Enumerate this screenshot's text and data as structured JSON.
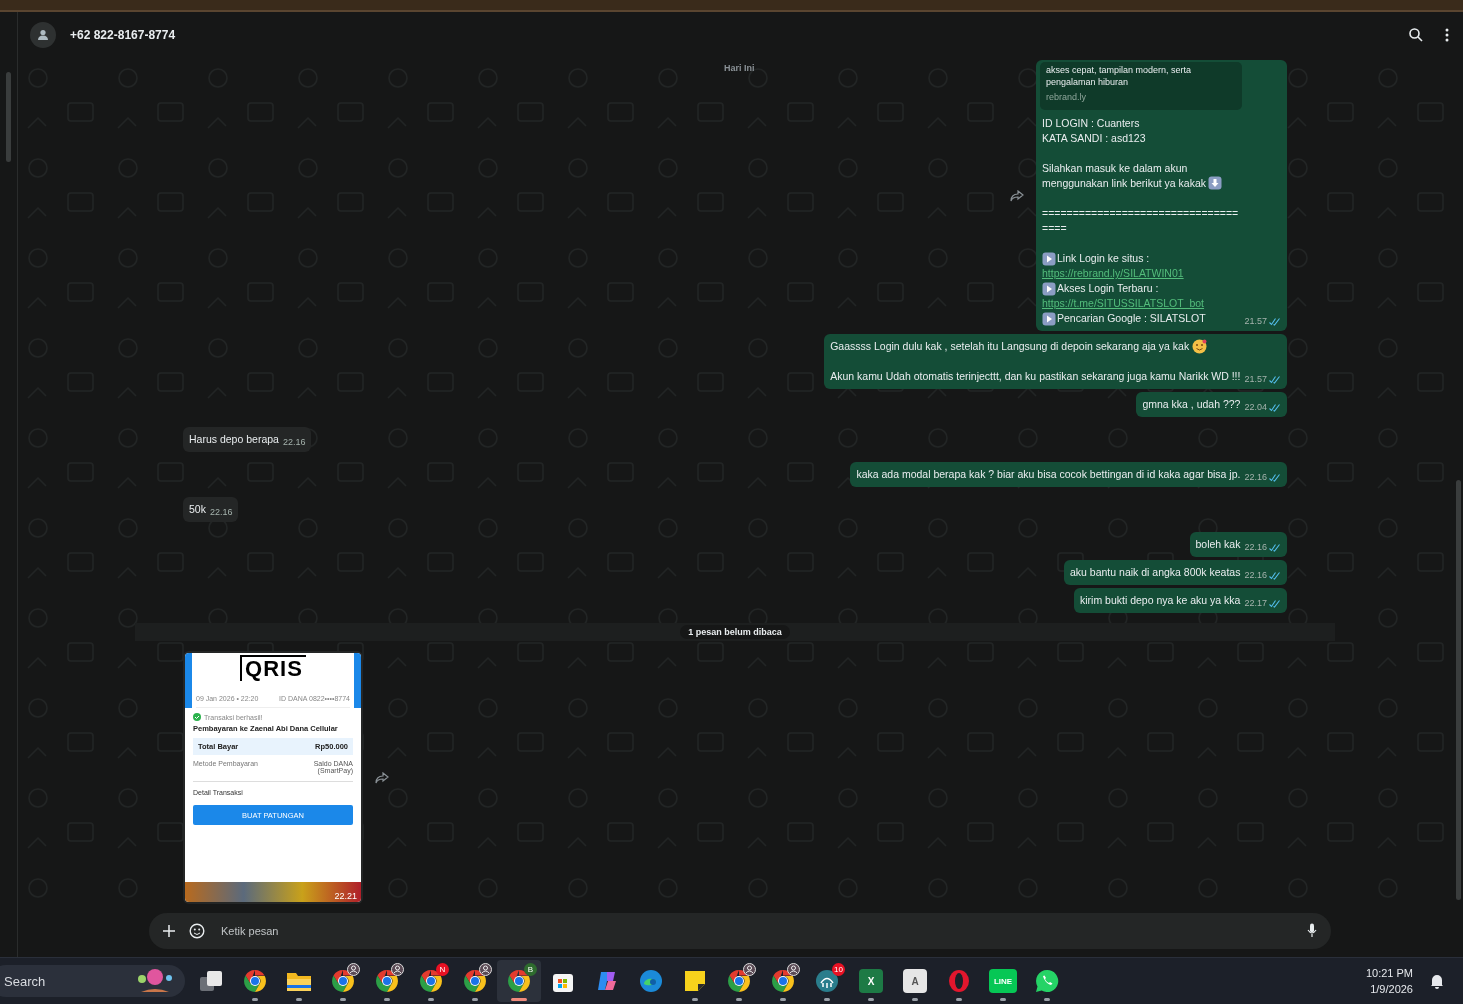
{
  "header": {
    "contact": "+62 822-8167-8774"
  },
  "date_chip": "Hari Ini",
  "messages": [
    {
      "kind": "outgoing_link",
      "show_forward": true,
      "preview": {
        "description": "akses cepat, tampilan modern, serta pengalaman hiburan",
        "domain": "rebrand.ly"
      },
      "lines": [
        {
          "kind": "text",
          "text": "ID LOGIN : Cuanters"
        },
        {
          "kind": "text",
          "text": "KATA SANDI : asd123"
        },
        {
          "kind": "blank"
        },
        {
          "kind": "arrowtext",
          "text": "Silahkan masuk ke dalam akun menggunakan link berikut ya kakak"
        },
        {
          "kind": "blank"
        },
        {
          "kind": "rule",
          "text": "===================================="
        },
        {
          "kind": "blank"
        },
        {
          "kind": "bullet",
          "text": "Link Login ke situs  :"
        },
        {
          "kind": "link",
          "text": "https://rebrand.ly/SILATWIN01"
        },
        {
          "kind": "bullet",
          "text": "Akses Login Terbaru :"
        },
        {
          "kind": "link",
          "text": "https://t.me/SITUSSILATSLOT_bot"
        },
        {
          "kind": "bullet",
          "text": "Pencarian Google : SILATSLOT"
        }
      ],
      "time": "21.57",
      "read": true
    },
    {
      "kind": "outgoing_text",
      "lines": [
        {
          "kind": "smiletext",
          "text": "Gaassss Login dulu kak , setelah itu Langsung di depoin sekarang aja ya kak"
        },
        {
          "kind": "blank"
        },
        {
          "kind": "text",
          "text": " Akun kamu Udah otomatis terinjecttt, dan ku pastikan sekarang juga kamu Narikk WD !!!"
        }
      ],
      "time": "21.57",
      "read": true
    },
    {
      "kind": "outgoing_text",
      "lines": [
        {
          "kind": "text",
          "text": "gmna kka , udah ???"
        }
      ],
      "time": "22.04",
      "read": true
    },
    {
      "kind": "incoming_text",
      "lines": [
        {
          "kind": "text",
          "text": "Harus depo berapa"
        }
      ],
      "time": "22.16"
    },
    {
      "kind": "outgoing_text",
      "lines": [
        {
          "kind": "text",
          "text": "kaka ada modal berapa kak ? biar aku bisa cocok bettingan di id kaka agar bisa jp."
        }
      ],
      "time": "22.16",
      "read": true
    },
    {
      "kind": "incoming_text",
      "lines": [
        {
          "kind": "text",
          "text": "50k"
        }
      ],
      "time": "22.16"
    },
    {
      "kind": "outgoing_text",
      "lines": [
        {
          "kind": "text",
          "text": "boleh kak"
        }
      ],
      "time": "22.16",
      "read": true
    },
    {
      "kind": "outgoing_text",
      "lines": [
        {
          "kind": "text",
          "text": "aku bantu naik di angka 800k keatas"
        }
      ],
      "time": "22.16",
      "read": true
    },
    {
      "kind": "outgoing_text",
      "lines": [
        {
          "kind": "text",
          "text": "kirim bukti depo nya ke aku ya kka"
        }
      ],
      "time": "22.17",
      "read": true
    },
    {
      "kind": "unread_divider",
      "label": "1 pesan belum dibaca"
    },
    {
      "kind": "incoming_image",
      "show_forward": true,
      "time": "22.21",
      "receipt": {
        "logo": "QRIS",
        "date": "09 Jan 2026 • 22:20",
        "account": "ID DANA 0822••••8774",
        "status": "Transaksi berhasil!",
        "title": "Pembayaran ke Zaenal Abi Dana Cellular",
        "total_label": "Total Bayar",
        "total": "Rp50.000",
        "method_label": "Metode Pembayaran",
        "method": "Saldo DANA (SmartPay)",
        "detail": "Detail Transaksi",
        "button": "BUAT PATUNGAN"
      }
    }
  ],
  "composer": {
    "placeholder": "Ketik pesan"
  },
  "taskbar": {
    "search": "Search",
    "items": [
      {
        "kind": "taskview",
        "running": false,
        "active": false
      },
      {
        "kind": "chrome",
        "running": true,
        "active": false
      },
      {
        "kind": "folder",
        "running": true,
        "active": false
      },
      {
        "kind": "chrome",
        "profile_badge": true,
        "running": true,
        "active": false
      },
      {
        "kind": "chrome",
        "profile_badge": true,
        "running": true,
        "active": false
      },
      {
        "kind": "chrome",
        "badge": "N",
        "running": true,
        "active": false
      },
      {
        "kind": "chrome",
        "profile_badge": true,
        "running": true,
        "active": false
      },
      {
        "kind": "chrome",
        "badge": "B",
        "running": true,
        "active": true
      },
      {
        "kind": "store",
        "running": false,
        "active": false
      },
      {
        "kind": "copilot",
        "running": false,
        "active": false
      },
      {
        "kind": "edge",
        "running": false,
        "active": false
      },
      {
        "kind": "notes",
        "running": true,
        "active": false
      },
      {
        "kind": "chrome",
        "profile_badge": true,
        "running": true,
        "active": false
      },
      {
        "kind": "chrome",
        "profile_badge": true,
        "running": true,
        "active": false
      },
      {
        "kind": "app",
        "badge": "10",
        "running": true,
        "active": false
      },
      {
        "kind": "excel",
        "label": "X",
        "running": true,
        "active": false
      },
      {
        "kind": "keyboard",
        "label": "A",
        "running": true,
        "active": false
      },
      {
        "kind": "opera",
        "running": true,
        "active": false
      },
      {
        "kind": "line",
        "label": "LINE",
        "running": true,
        "active": false
      },
      {
        "kind": "whatsapp",
        "running": true,
        "active": false
      }
    ],
    "time": "10:21 PM",
    "date": "1/9/2026"
  }
}
